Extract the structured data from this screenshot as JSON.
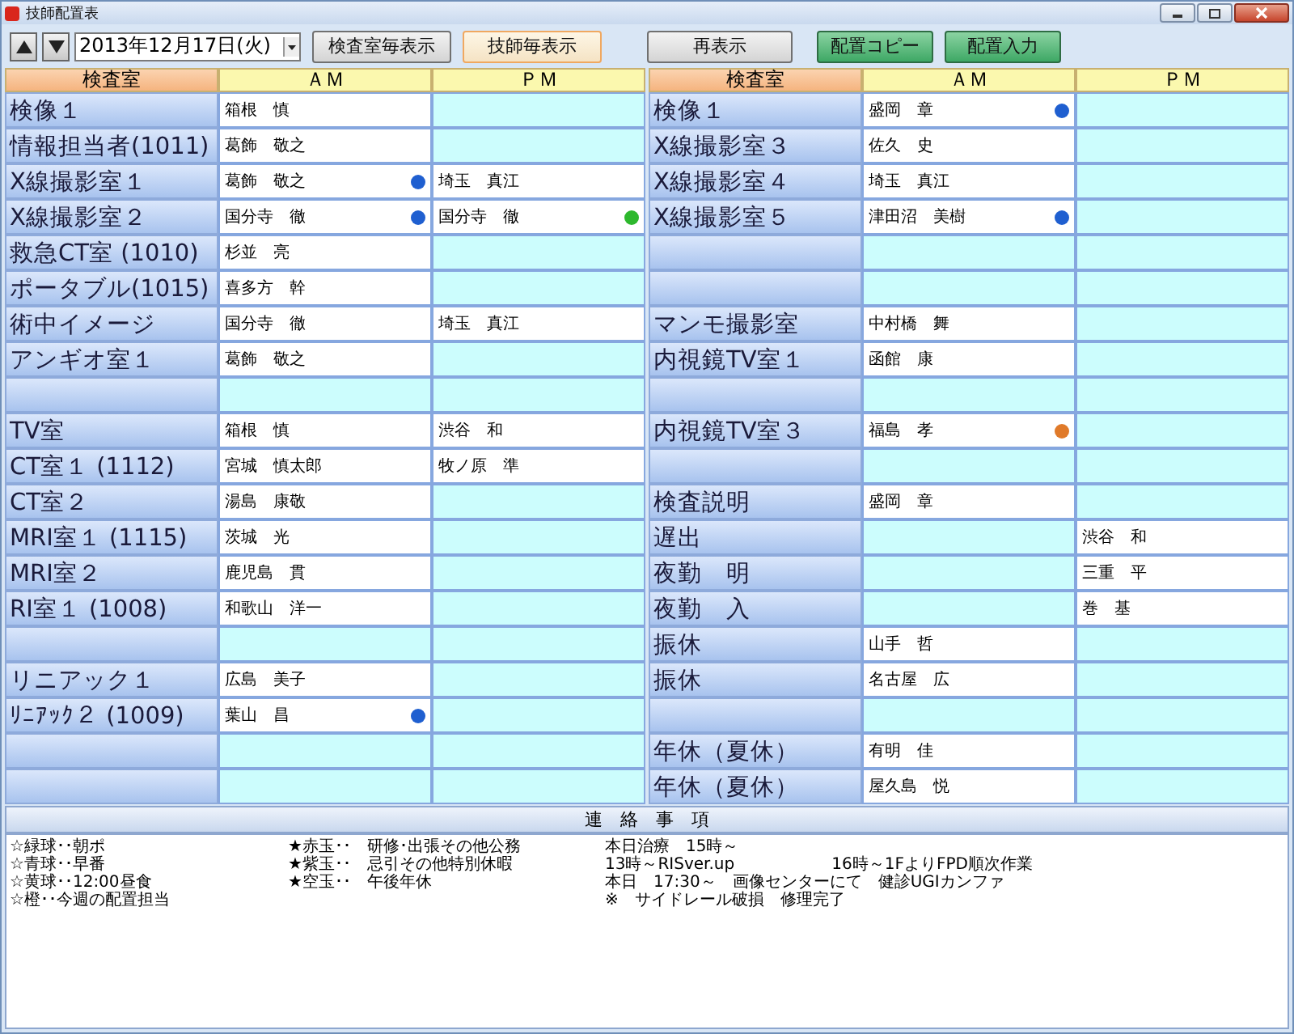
{
  "window": {
    "title": "技師配置表"
  },
  "toolbar": {
    "date": "2013年12月17日(火)",
    "view_buttons": [
      {
        "label": "検査室毎表示",
        "selected": false
      },
      {
        "label": "技師毎表示",
        "selected": true
      }
    ],
    "buttons": [
      {
        "label": "再表示",
        "kind": "gray"
      },
      {
        "label": "配置コピー",
        "kind": "green"
      },
      {
        "label": "配置入力",
        "kind": "green"
      }
    ]
  },
  "tables": [
    {
      "header": {
        "room": "検査室",
        "am": "ＡＭ",
        "pm": "ＰＭ"
      },
      "rows": [
        {
          "room": "検像１",
          "am": {
            "name": "箱根　慎"
          }
        },
        {
          "room": "情報担当者(1011)",
          "am": {
            "name": "葛飾　敬之"
          }
        },
        {
          "room": "X線撮影室１",
          "am": {
            "name": "葛飾　敬之",
            "color": "#1f5fd0"
          },
          "pm": {
            "name": "埼玉　真江"
          }
        },
        {
          "room": "X線撮影室２",
          "am": {
            "name": "国分寺　徹",
            "color": "#1f5fd0"
          },
          "pm": {
            "name": "国分寺　徹",
            "color": "#2db82d"
          }
        },
        {
          "room": "救急CT室 (1010)",
          "am": {
            "name": "杉並　亮"
          }
        },
        {
          "room": "ポータブル(1015)",
          "am": {
            "name": "喜多方　幹"
          }
        },
        {
          "room": "術中イメージ",
          "am": {
            "name": "国分寺　徹"
          },
          "pm": {
            "name": "埼玉　真江"
          }
        },
        {
          "room": "アンギオ室１",
          "am": {
            "name": "葛飾　敬之"
          }
        },
        {},
        {
          "room": "TV室",
          "am": {
            "name": "箱根　慎"
          },
          "pm": {
            "name": "渋谷　和"
          }
        },
        {
          "room": "CT室１ (1112)",
          "am": {
            "name": "宮城　慎太郎"
          },
          "pm": {
            "name": "牧ノ原　準"
          }
        },
        {
          "room": "CT室２",
          "am": {
            "name": "湯島　康敬"
          }
        },
        {
          "room": "MRI室１ (1115)",
          "am": {
            "name": "茨城　光"
          }
        },
        {
          "room": "MRI室２",
          "am": {
            "name": "鹿児島　貫"
          }
        },
        {
          "room": "RI室１ (1008)",
          "am": {
            "name": "和歌山　洋一"
          }
        },
        {},
        {
          "room": "リニアック１",
          "am": {
            "name": "広島　美子"
          }
        },
        {
          "room": "ﾘﾆｱｯｸ２ (1009)",
          "am": {
            "name": "葉山　昌",
            "color": "#1f5fd0"
          }
        },
        {},
        {}
      ]
    },
    {
      "header": {
        "room": "検査室",
        "am": "ＡＭ",
        "pm": "ＰＭ"
      },
      "rows": [
        {
          "room": "検像１",
          "am": {
            "name": "盛岡　章",
            "color": "#1f5fd0"
          }
        },
        {
          "room": "X線撮影室３",
          "am": {
            "name": "佐久　史"
          }
        },
        {
          "room": "X線撮影室４",
          "am": {
            "name": "埼玉　真江"
          }
        },
        {
          "room": "X線撮影室５",
          "am": {
            "name": "津田沼　美樹",
            "color": "#1f5fd0"
          }
        },
        {},
        {},
        {
          "room": "マンモ撮影室",
          "am": {
            "name": "中村橋　舞"
          }
        },
        {
          "room": "内視鏡TV室１",
          "am": {
            "name": "函館　康"
          }
        },
        {},
        {
          "room": "内視鏡TV室３",
          "am": {
            "name": "福島　孝",
            "color": "#e07a2a"
          }
        },
        {},
        {
          "room": "検査説明",
          "am": {
            "name": "盛岡　章"
          }
        },
        {
          "room": "遅出",
          "pm": {
            "name": "渋谷　和"
          }
        },
        {
          "room": "夜勤　明",
          "pm": {
            "name": "三重　平"
          }
        },
        {
          "room": "夜勤　入",
          "pm": {
            "name": "巻　基"
          }
        },
        {
          "room": "振休",
          "am": {
            "name": "山手　哲"
          }
        },
        {
          "room": "振休",
          "am": {
            "name": "名古屋　広"
          }
        },
        {},
        {
          "room": "年休（夏休）",
          "am": {
            "name": "有明　佳"
          }
        },
        {
          "room": "年休（夏休）",
          "am": {
            "name": "屋久島　悦"
          }
        }
      ]
    }
  ],
  "notes": {
    "title": "連　絡　事　項",
    "columns": [
      [
        [
          "☆緑球･･朝ポ"
        ],
        [
          "☆青球･･早番"
        ],
        [
          "☆黄球･･12:00昼食"
        ],
        [
          "☆橙･･今週の配置担当"
        ]
      ],
      [
        [
          "★赤玉･･　研修･出張その他公務"
        ],
        [
          "★紫玉･･　忌引その他特別休暇"
        ],
        [
          "★空玉･･　午後年休"
        ]
      ],
      [
        [
          "本日治療　15時～"
        ],
        [
          "13時～RISver.up",
          "16時～1FよりFPD順次作業"
        ],
        [
          "本日　17:30～　画像センターにて　健診UGIカンファ"
        ],
        [
          "※　サイドレール破損　修理完了"
        ]
      ]
    ]
  }
}
